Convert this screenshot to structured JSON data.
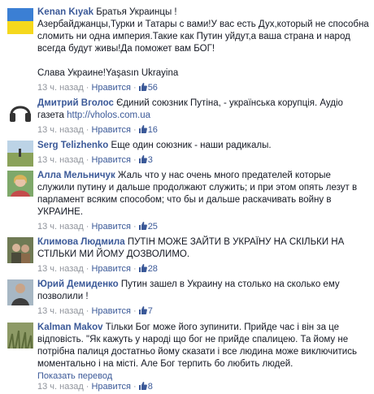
{
  "comments": [
    {
      "author": "Kenan Kıyak",
      "lines": [
        "Братья Украинцы !",
        "Азербайджанцы,Турки и Татары с вами!У вас есть Дух,который не способна",
        "сломить ни одна империя.Такие как Путин уйдут,а ваша страна и народ",
        "всегда будут живы!Да поможет вам БОГ!"
      ],
      "extra": "Слава Украине!Yaşasın Ukrayina",
      "time": "13 ч. назад",
      "like_label": "Нравится",
      "likes": "56",
      "avatar": "ukraine-flag"
    },
    {
      "author": "Дмитрий Вголос",
      "text": "Єдиний союзник Путіна, - українська корупція. Аудіо газета",
      "link": "http://vholos.com.ua",
      "time": "13 ч. назад",
      "like_label": "Нравится",
      "likes": "16",
      "avatar": "headphones"
    },
    {
      "author": "Serg Telizhenko",
      "text": "Еще один союзник - наши радикалы.",
      "time": "13 ч. назад",
      "like_label": "Нравится",
      "likes": "3",
      "avatar": "field-photo"
    },
    {
      "author": "Алла Мельничук",
      "lines": [
        "Жаль что у нас очень много предателей которые",
        "служили путину и дальше продолжают служить; и при этом опять лезут в",
        "парламент всяким способом; что бы и дальше раскачивать войну в",
        "УКРАИНЕ."
      ],
      "time": "13 ч. назад",
      "like_label": "Нравится",
      "likes": "25",
      "avatar": "woman-photo"
    },
    {
      "author": "Климова Людмила",
      "lines": [
        "ПУТІН МОЖЕ ЗАЙТИ В УКРАЇНУ НА СКІЛЬКИ НА",
        "СТІЛЬКИ МИ ЙОМУ ДОЗВОЛИМО."
      ],
      "time": "13 ч. назад",
      "like_label": "Нравится",
      "likes": "28",
      "avatar": "people-photo"
    },
    {
      "author": "Юрий Демиденко",
      "lines": [
        "Путин зашел в Украину на столько на сколько ему",
        "позволили !"
      ],
      "time": "13 ч. назад",
      "like_label": "Нравится",
      "likes": "7",
      "avatar": "man-photo"
    },
    {
      "author": "Kalman Makov",
      "lines": [
        "Тільки Бог може його зупинити. Прийде час і він за це",
        "відповість. \"Як кажуть у народі що бог не прийде спалицею. Та йому не",
        "потрібна палиця достатньо йому сказати і все людина може виключитись",
        "моментально і на місті. Але Бог терпить бо любить людей."
      ],
      "translate": "Показать перевод",
      "time": "13 ч. назад",
      "like_label": "Нравится",
      "likes": "8",
      "avatar": "grass-photo"
    }
  ]
}
